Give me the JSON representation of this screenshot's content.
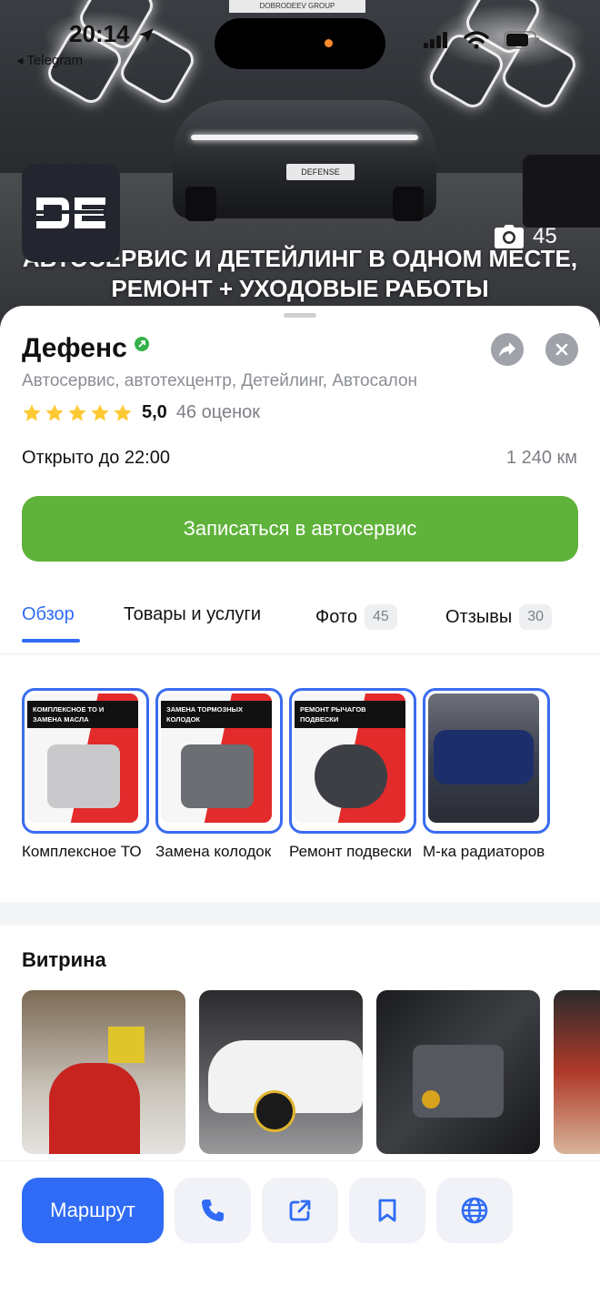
{
  "status_bar": {
    "time": "20:14",
    "back_label": "◂ Telegram"
  },
  "hero": {
    "title": "АВТОСЕРВИС И ДЕТЕЙЛИНГ В ОДНОМ МЕСТЕ, РЕМОНТ + УХОДОВЫЕ РАБОТЫ",
    "photo_count": "45",
    "banner_text": "DOBRODEEV GROUP",
    "plate_text": "DEFENSE"
  },
  "org": {
    "name": "Дефенс",
    "categories": "Автосервис, автотехцентр, Детейлинг, Автосалон",
    "rating_value": "5,0",
    "rating_stars": 5,
    "rating_count": "46 оценок",
    "open_status": "Открыто до 22:00",
    "distance": "1 240 км"
  },
  "cta": {
    "label": "Записаться в автосервис"
  },
  "tabs": [
    {
      "label": "Обзор",
      "count": ""
    },
    {
      "label": "Товары и услуги",
      "count": ""
    },
    {
      "label": "Фото",
      "count": "45"
    },
    {
      "label": "Отзывы",
      "count": "30"
    }
  ],
  "services": [
    {
      "label": "Комплексное ТО",
      "banner": "Комплексное ТО и замена масла"
    },
    {
      "label": "Замена колодок",
      "banner": "Замена тормозных колодок"
    },
    {
      "label": "Ремонт подвески",
      "banner": "Ремонт рычагов подвески"
    },
    {
      "label": "М-ка радиаторов",
      "banner": ""
    }
  ],
  "showcase": {
    "title": "Витрина"
  },
  "bottom": {
    "route_label": "Маршрут"
  },
  "colors": {
    "accent_blue": "#2f6bf5",
    "cta_green": "#5fb23a",
    "star_yellow": "#ffc933",
    "verified_green": "#35b24a"
  }
}
